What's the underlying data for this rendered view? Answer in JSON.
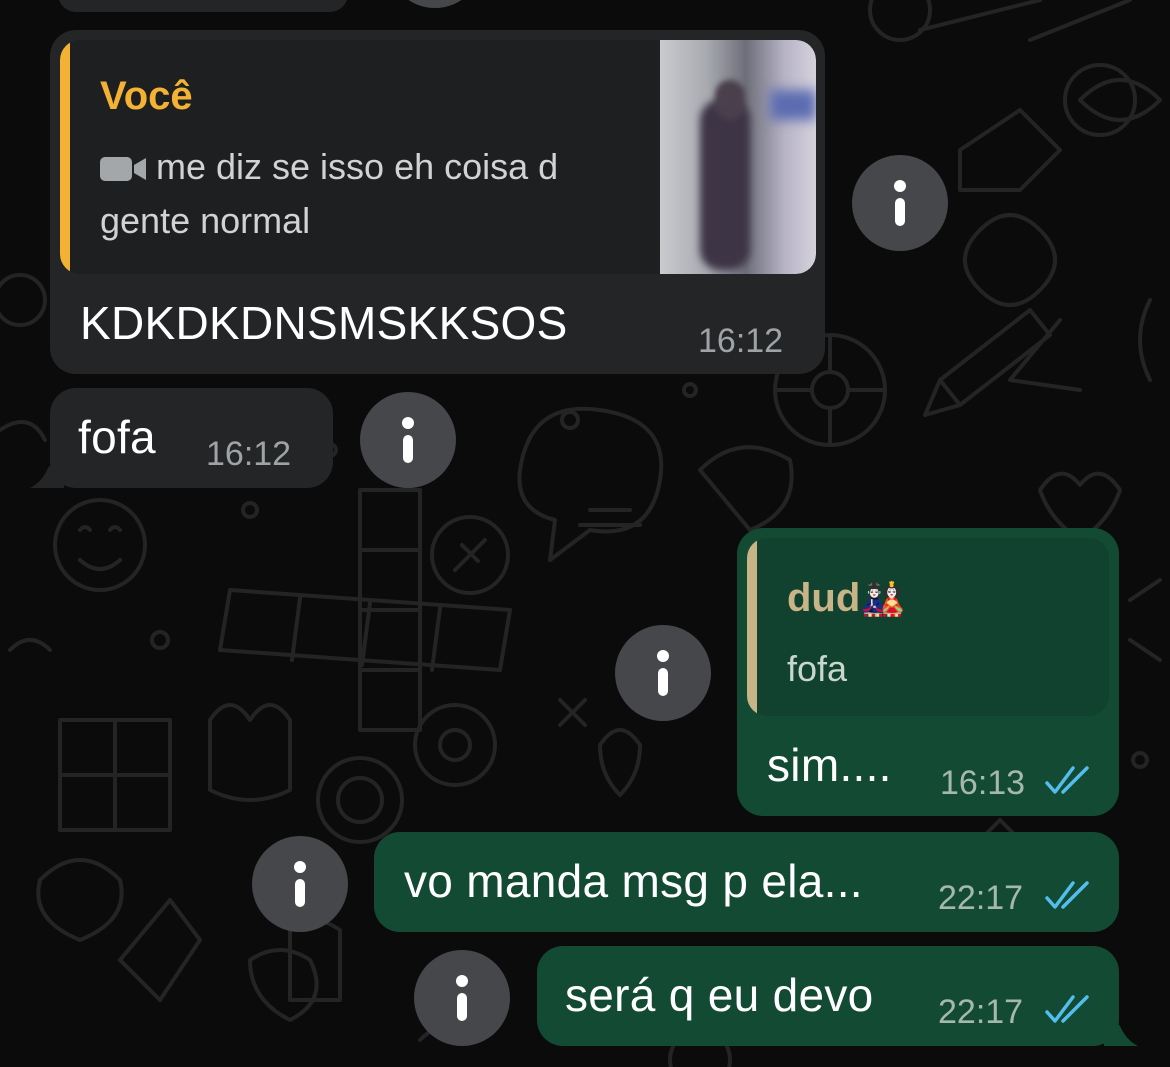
{
  "messages": [
    {
      "direction": "incoming",
      "reply": {
        "author": "Você",
        "media_icon": "video-camera-icon",
        "text": "me diz se isso eh coisa d gente normal",
        "thumbnail": "video-thumbnail"
      },
      "text": "KDKDKDNSMSKKSOS",
      "time": "16:12"
    },
    {
      "direction": "incoming",
      "text": "fofa",
      "time": "16:12"
    },
    {
      "direction": "outgoing",
      "reply": {
        "author": "dud",
        "author_emoji": "🎎",
        "text": "fofa"
      },
      "text": "sim....",
      "time": "16:13",
      "status": "read"
    },
    {
      "direction": "outgoing",
      "text": "vo manda msg p ela...",
      "time": "22:17",
      "status": "read"
    },
    {
      "direction": "outgoing",
      "text": "será q eu devo",
      "time": "22:17",
      "status": "read"
    }
  ],
  "info_button": {
    "label": "i"
  },
  "colors": {
    "background": "#0b0b0b",
    "incoming_bubble": "#242526",
    "outgoing_bubble": "#134a34",
    "reply_author_self": "#f3b234",
    "reply_author_contact": "#c9b487",
    "read_ticks": "#53bdeb",
    "info_button": "#45474a"
  }
}
